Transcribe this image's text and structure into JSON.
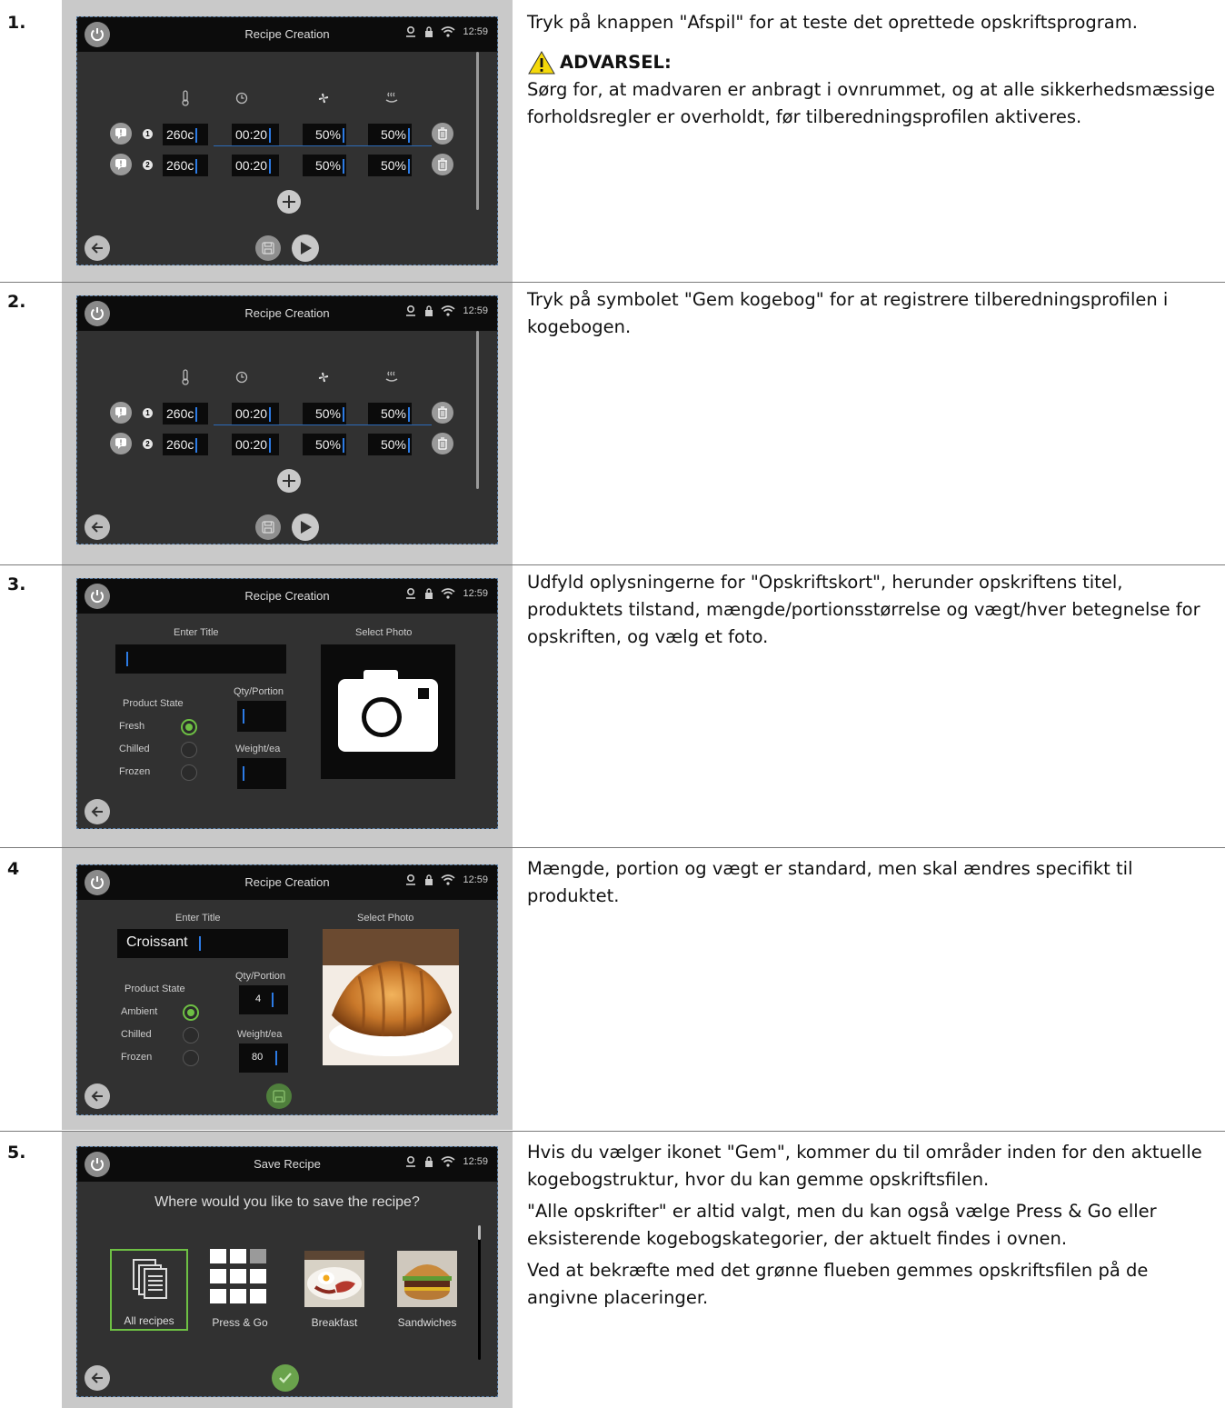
{
  "steps": [
    {
      "num": "1.",
      "screen": {
        "title": "Recipe Creation",
        "time": "12:59",
        "rows": [
          {
            "idx": "1",
            "temp": "260c",
            "time": "00:20",
            "fan": "50%",
            "humidity": "50%"
          },
          {
            "idx": "2",
            "temp": "260c",
            "time": "00:20",
            "fan": "50%",
            "humidity": "50%"
          }
        ]
      },
      "text": "Tryk på knappen \"Afspil\" for at teste det oprettede opskriftsprogram.",
      "warning_title": "ADVARSEL:",
      "warning_text": "Sørg for, at madvaren er anbragt i ovnrummet, og at alle sikkerhedsmæssige forholdsregler er overholdt, før tilberedningsprofilen aktiveres."
    },
    {
      "num": "2.",
      "screen": {
        "title": "Recipe Creation",
        "time": "12:59",
        "rows": [
          {
            "idx": "1",
            "temp": "260c",
            "time": "00:20",
            "fan": "50%",
            "humidity": "50%"
          },
          {
            "idx": "2",
            "temp": "260c",
            "time": "00:20",
            "fan": "50%",
            "humidity": "50%"
          }
        ]
      },
      "text": "Tryk på symbolet \"Gem kogebog\" for at registrere tilberedningsprofilen i kogebogen."
    },
    {
      "num": "3.",
      "screen": {
        "title": "Recipe Creation",
        "time": "12:59",
        "enter_title": "Enter Title",
        "select_photo": "Select Photo",
        "product_state": "Product State",
        "states": [
          "Fresh",
          "Chilled",
          "Frozen"
        ],
        "qty_portion": "Qty/Portion",
        "weight_ea": "Weight/ea"
      },
      "text": "Udfyld oplysningerne for \"Opskriftskort\", herunder opskriftens titel, produktets tilstand, mængde/portionsstørrelse og vægt/hver betegnelse for opskriften, og vælg et foto."
    },
    {
      "num": "4",
      "screen": {
        "title": "Recipe Creation",
        "time": "12:59",
        "enter_title": "Enter Title",
        "title_value": "Croissant",
        "select_photo": "Select Photo",
        "product_state": "Product State",
        "states": [
          "Ambient",
          "Chilled",
          "Frozen"
        ],
        "qty_portion": "Qty/Portion",
        "qty_value": "4",
        "weight_ea": "Weight/ea",
        "weight_value": "80"
      },
      "text": "Mængde, portion og vægt er standard, men skal ændres specifikt til produktet."
    },
    {
      "num": "5.",
      "screen": {
        "title": "Save Recipe",
        "time": "12:59",
        "question": "Where would you like to save the recipe?",
        "tiles": [
          "All recipes",
          "Press & Go",
          "Breakfast",
          "Sandwiches"
        ]
      },
      "paragraphs": [
        "Hvis du vælger ikonet \"Gem\", kommer du til områder inden for den aktuelle kogebogstruktur, hvor du kan gemme opskriftsfilen.",
        "\"Alle opskrifter\" er altid valgt, men du kan også vælge Press & Go eller eksisterende kogebogskategorier, der aktuelt findes i ovnen.",
        "Ved at bekræfte med det grønne flueben gemmes opskriftsfilen på de angivne placeringer."
      ]
    }
  ],
  "colors": {
    "accent_blue": "#2c7be5",
    "green": "#6ec044",
    "screen_bg": "#313131",
    "warning_yellow": "#f5d90a"
  }
}
